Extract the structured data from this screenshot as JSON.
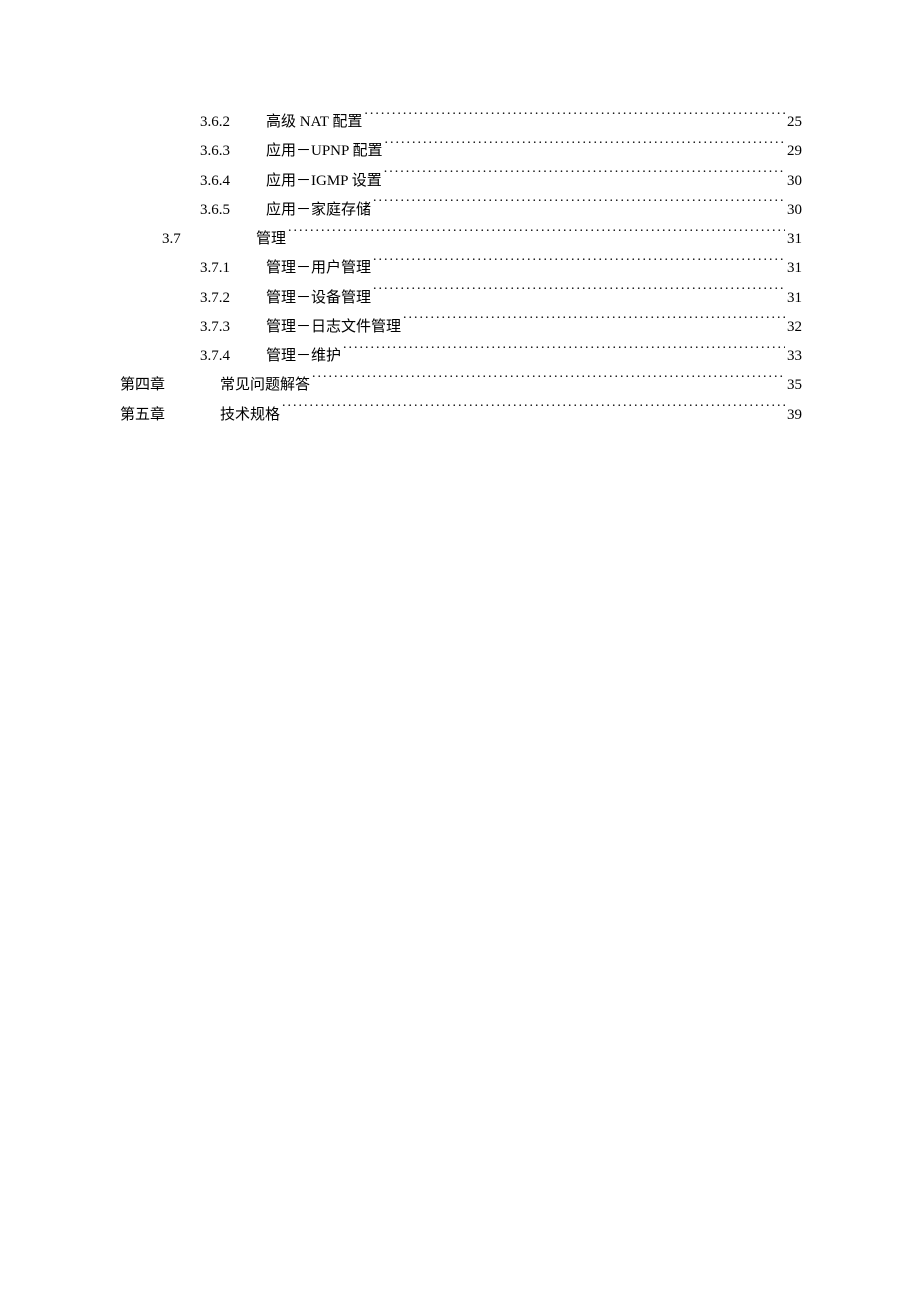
{
  "toc": [
    {
      "level": 3,
      "num": "3.6.2",
      "title": "高级 NAT 配置 ",
      "page": "25"
    },
    {
      "level": 3,
      "num": "3.6.3",
      "title": "应用－UPNP 配置 ",
      "page": "29"
    },
    {
      "level": 3,
      "num": "3.6.4",
      "title": "应用－IGMP 设置",
      "page": "30"
    },
    {
      "level": 3,
      "num": "3.6.5",
      "title": "应用－家庭存储",
      "page": "30"
    },
    {
      "level": 2,
      "num": "3.7",
      "title": "管理",
      "page": "31"
    },
    {
      "level": 3,
      "num": "3.7.1",
      "title": "管理－用户管理",
      "page": "31"
    },
    {
      "level": 3,
      "num": "3.7.2",
      "title": "管理－设备管理",
      "page": "31"
    },
    {
      "level": 3,
      "num": "3.7.3",
      "title": "管理－日志文件管理",
      "page": "32"
    },
    {
      "level": 3,
      "num": "3.7.4",
      "title": "管理－维护",
      "page": "33"
    },
    {
      "level": 1,
      "num": "第四章",
      "title": "常见问题解答",
      "page": "35"
    },
    {
      "level": 1,
      "num": "第五章",
      "title": "技术规格",
      "page": "39"
    }
  ]
}
